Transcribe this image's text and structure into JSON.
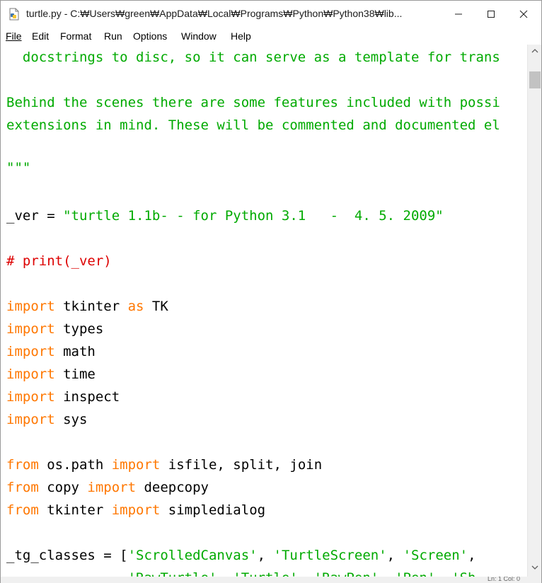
{
  "window": {
    "title": "turtle.py - C:₩Users₩green₩AppData₩Local₩Programs₩Python₩Python38₩lib...",
    "icon": "python-file-icon"
  },
  "menu": {
    "file": "File",
    "edit": "Edit",
    "format": "Format",
    "run": "Run",
    "options": "Options",
    "window": "Window",
    "help": "Help"
  },
  "code": {
    "line1": "  docstrings to disc, so it can serve as a template for trans",
    "line2": "Behind the scenes there are some features included with possi",
    "line3": "extensions in mind. These will be commented and documented el",
    "line4": "\"\"\"",
    "line5_var": "_ver = ",
    "line5_str": "\"turtle 1.1b- - for Python 3.1   -  4. 5. 2009\"",
    "line6": "# print(_ver)",
    "kw_import": "import",
    "kw_from": "from",
    "kw_as": "as",
    "mod_tkinter": " tkinter ",
    "mod_tk": " TK",
    "mod_types": " types",
    "mod_math": " math",
    "mod_time": " time",
    "mod_inspect": " inspect",
    "mod_sys": " sys",
    "from1_mod": " os.path ",
    "from1_names": " isfile, split, join",
    "from2_mod": " copy ",
    "from2_names": " deepcopy",
    "from3_mod": " tkinter ",
    "from3_names": " simpledialog",
    "tg_prefix": "_tg_classes = [",
    "tg_s1": "'ScrolledCanvas'",
    "tg_sep1": ", ",
    "tg_s2": "'TurtleScreen'",
    "tg_sep2": ", ",
    "tg_s3": "'Screen'",
    "tg_end": ",",
    "tg_next": "               'RawTurtle', 'Turtle', 'RawPen', 'Pen', 'Sh"
  },
  "status": {
    "position": "Ln: 1  Col: 0"
  },
  "colors": {
    "string": "#00aa00",
    "comment": "#dd0000",
    "keyword": "#ff7700"
  }
}
